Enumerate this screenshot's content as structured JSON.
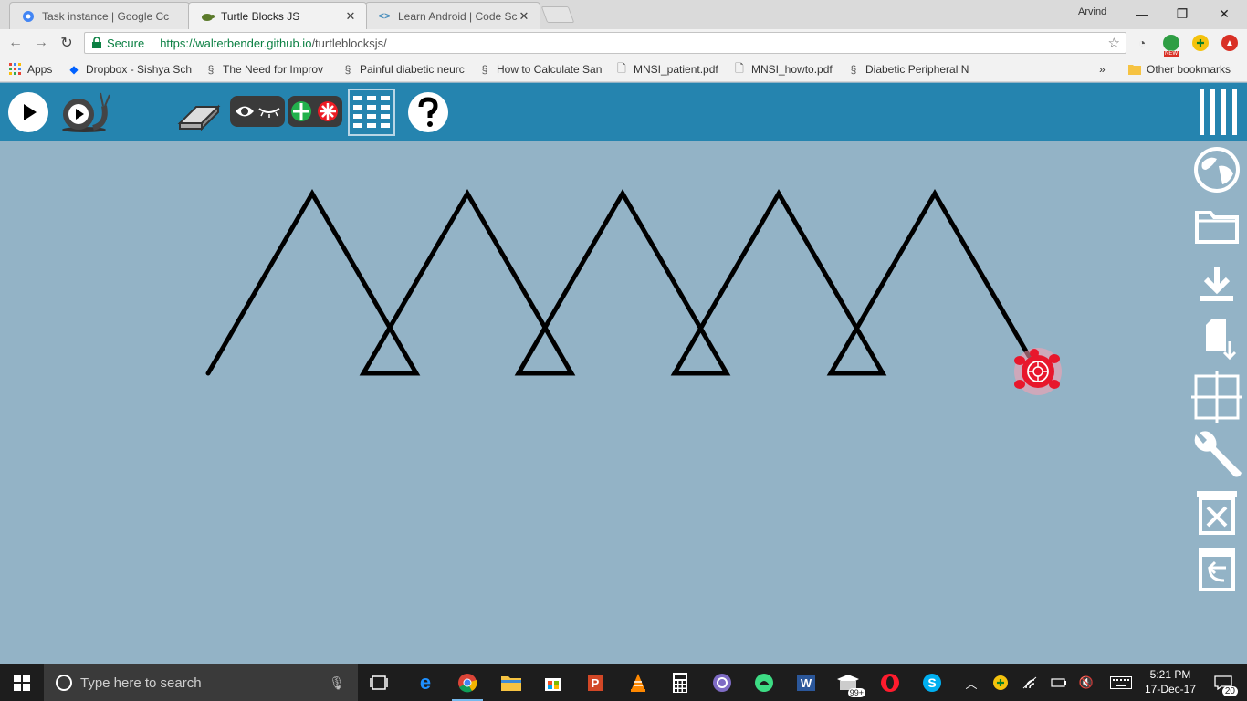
{
  "browser": {
    "tabs": [
      {
        "title": "Task instance | Google Cc",
        "icon": "gear-icon"
      },
      {
        "title": "Turtle Blocks JS",
        "icon": "turtle-icon",
        "active": true
      },
      {
        "title": "Learn Android | Code Sch",
        "icon": "code-icon"
      }
    ],
    "profile_name": "Arvind",
    "secure_label": "Secure",
    "url_base": "https://walterbender.github.io",
    "url_path": "/turtleblocksjs/",
    "ext_new_badge": "NEW"
  },
  "bookmarks": {
    "apps_label": "Apps",
    "items": [
      {
        "label": "Dropbox - Sishya Sch",
        "icon": "dropbox-icon"
      },
      {
        "label": "The Need for Improv",
        "icon": "link-icon"
      },
      {
        "label": "Painful diabetic neurc",
        "icon": "link-icon"
      },
      {
        "label": "How to Calculate San",
        "icon": "link-icon"
      },
      {
        "label": "MNSI_patient.pdf",
        "icon": "file-icon"
      },
      {
        "label": "MNSI_howto.pdf",
        "icon": "file-icon"
      },
      {
        "label": "Diabetic Peripheral N",
        "icon": "link-icon"
      }
    ],
    "overflow": "»",
    "other_label": "Other bookmarks"
  },
  "turtle_toolbar": {
    "buttons": [
      "run-button",
      "run-slow-button",
      "clean-button",
      "hide-show-blocks-button",
      "collapse-expand-button",
      "palette-grid-button",
      "help-button"
    ]
  },
  "drawing": {
    "description_colors": {
      "line": "#000000",
      "turtle": "#e8172c",
      "glow": "#ff9fb0"
    },
    "line_width": 5
  },
  "aux_toolbar": {
    "buttons": [
      "menu-icon",
      "globe-icon",
      "folder-icon",
      "download-icon",
      "save-file-icon",
      "grid-icon",
      "wrench-icon",
      "clear-icon",
      "restore-trash-icon"
    ]
  },
  "taskbar": {
    "search_placeholder": "Type here to search",
    "time": "5:21 PM",
    "date": "17-Dec-17",
    "notification_count": "20",
    "badge_count": "99+"
  }
}
